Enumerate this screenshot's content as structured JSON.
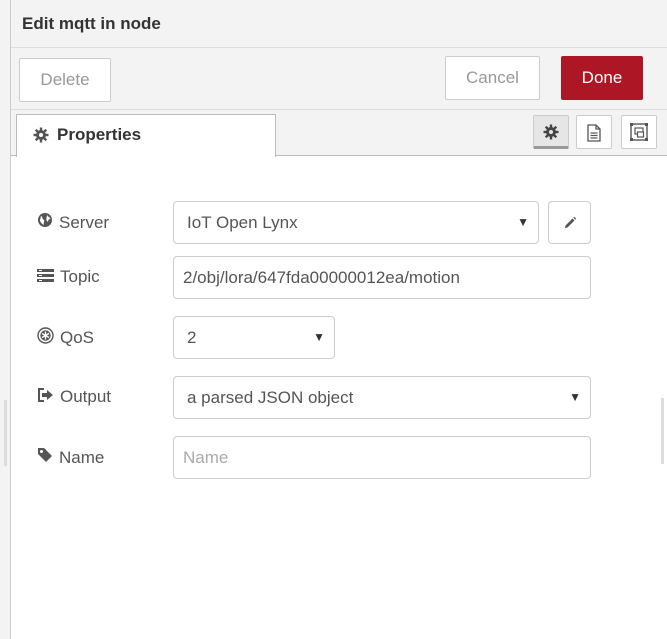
{
  "header": {
    "title": "Edit mqtt in node"
  },
  "toolbar": {
    "delete_label": "Delete",
    "cancel_label": "Cancel",
    "done_label": "Done"
  },
  "tabs": {
    "properties_label": "Properties",
    "icons": [
      "gear-icon",
      "description-icon",
      "appearance-icon"
    ]
  },
  "form": {
    "server": {
      "label": "Server",
      "value": "IoT Open Lynx"
    },
    "topic": {
      "label": "Topic",
      "value": "2/obj/lora/647fda00000012ea/motion"
    },
    "qos": {
      "label": "QoS",
      "value": "2"
    },
    "output": {
      "label": "Output",
      "value": "a parsed JSON object"
    },
    "name": {
      "label": "Name",
      "value": "",
      "placeholder": "Name"
    }
  },
  "colors": {
    "done": "#ad1625",
    "header_bg": "#f3f3f3",
    "border": "#cccccc"
  }
}
